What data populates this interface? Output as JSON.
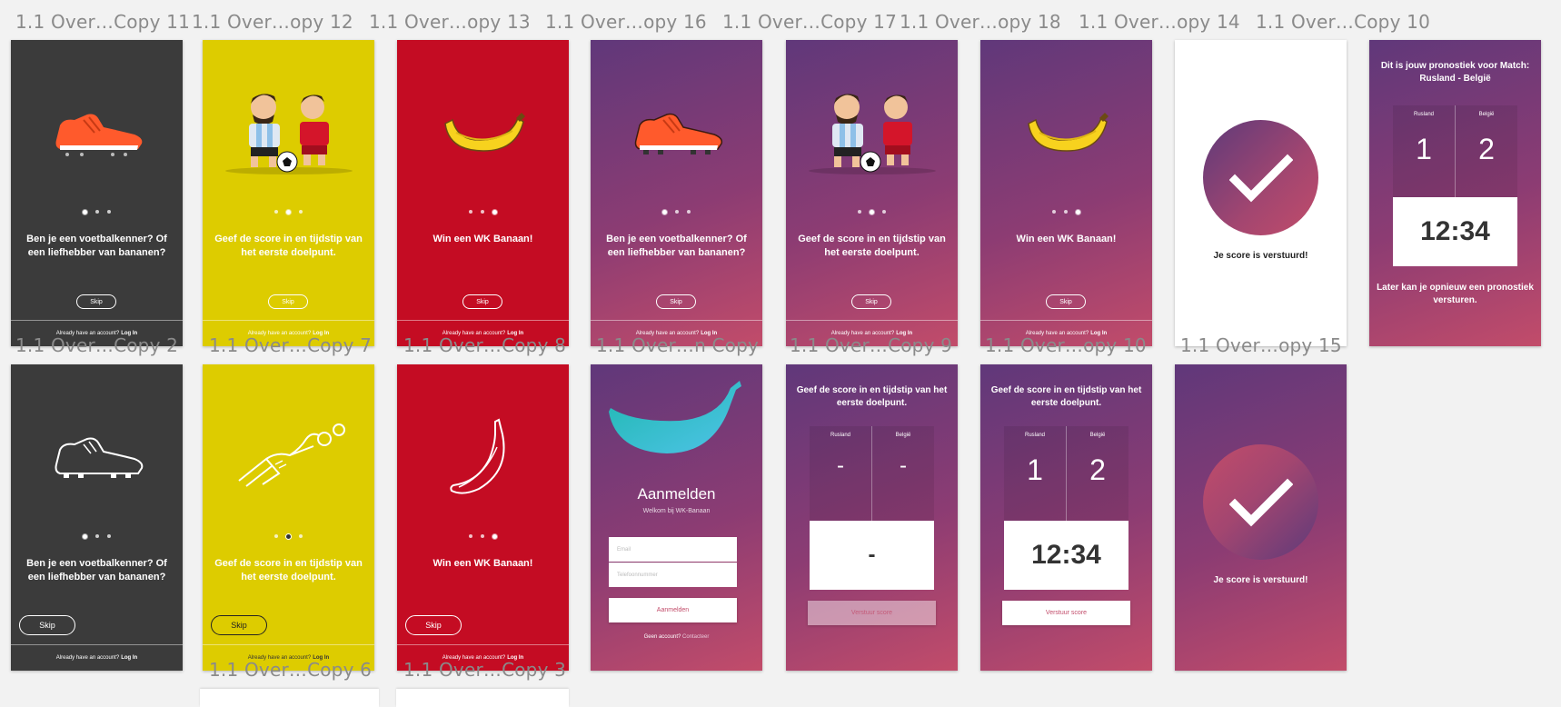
{
  "canvas_labels": {
    "c11": "1.1 Over…Copy 11",
    "c12": "1.1 Over…opy 12",
    "c13": "1.1 Over…opy 13",
    "c16": "1.1 Over…opy 16",
    "c17": "1.1 Over…Copy 17",
    "c18": "1.1 Over…opy 18",
    "c14": "1.1 Over…opy 14",
    "c10top": "1.1 Over…Copy 10",
    "c2": "1.1 Over…Copy 2",
    "c7": "1.1 Over…Copy 7",
    "c8": "1.1 Over…Copy 8",
    "cn": "1.1 Over…n Copy",
    "c9": "1.1 Over…Copy 9",
    "c10": "1.1 Over…opy 10",
    "c15": "1.1 Over…opy 15",
    "c6": "1.1 Over…Copy 6",
    "c3": "1.1 Over…Copy 3"
  },
  "onboarding": {
    "slide1": "Ben je een voetbalkenner? Of een liefhebber van bananen?",
    "slide2": "Geef de score in en tijdstip van het eerste doelpunt.",
    "slide3": "Win een WK Banaan!",
    "skip": "Skip",
    "footer_text": "Already have an account?",
    "footer_link": "Log In"
  },
  "prediction": {
    "title": "Geef de score in en tijdstip van het eerste doelpunt.",
    "team_home": "Rusland",
    "team_away": "België",
    "empty_score": "-",
    "score_home": "1",
    "score_away": "2",
    "time": "12:34",
    "empty_time": "-",
    "submit": "Verstuur score"
  },
  "confirmation": {
    "message": "Je score is verstuurd!"
  },
  "summary": {
    "title": "Dit is jouw pronostiek voor Match: Rusland - België",
    "footer": "Later kan je opnieuw een pronostiek versturen."
  },
  "login": {
    "title": "Aanmelden",
    "subtitle": "Welkom bij WK-Banaan",
    "email_placeholder": "Email",
    "phone_placeholder": "Telefoonnummer",
    "button": "Aanmelden",
    "no_account": "Geen account?",
    "contact": "Contacteer"
  },
  "icons": {
    "shoe": "football-boot-icon",
    "players": "soccer-players-icon",
    "banana": "banana-icon",
    "goalkeeper": "goalkeeper-icon",
    "check": "checkmark-icon"
  },
  "colors": {
    "dark": "#3b3b3b",
    "yellow": "#ddcc00",
    "red": "#c40c23",
    "purple_start": "#60387a",
    "purple_end": "#c24c6a"
  }
}
